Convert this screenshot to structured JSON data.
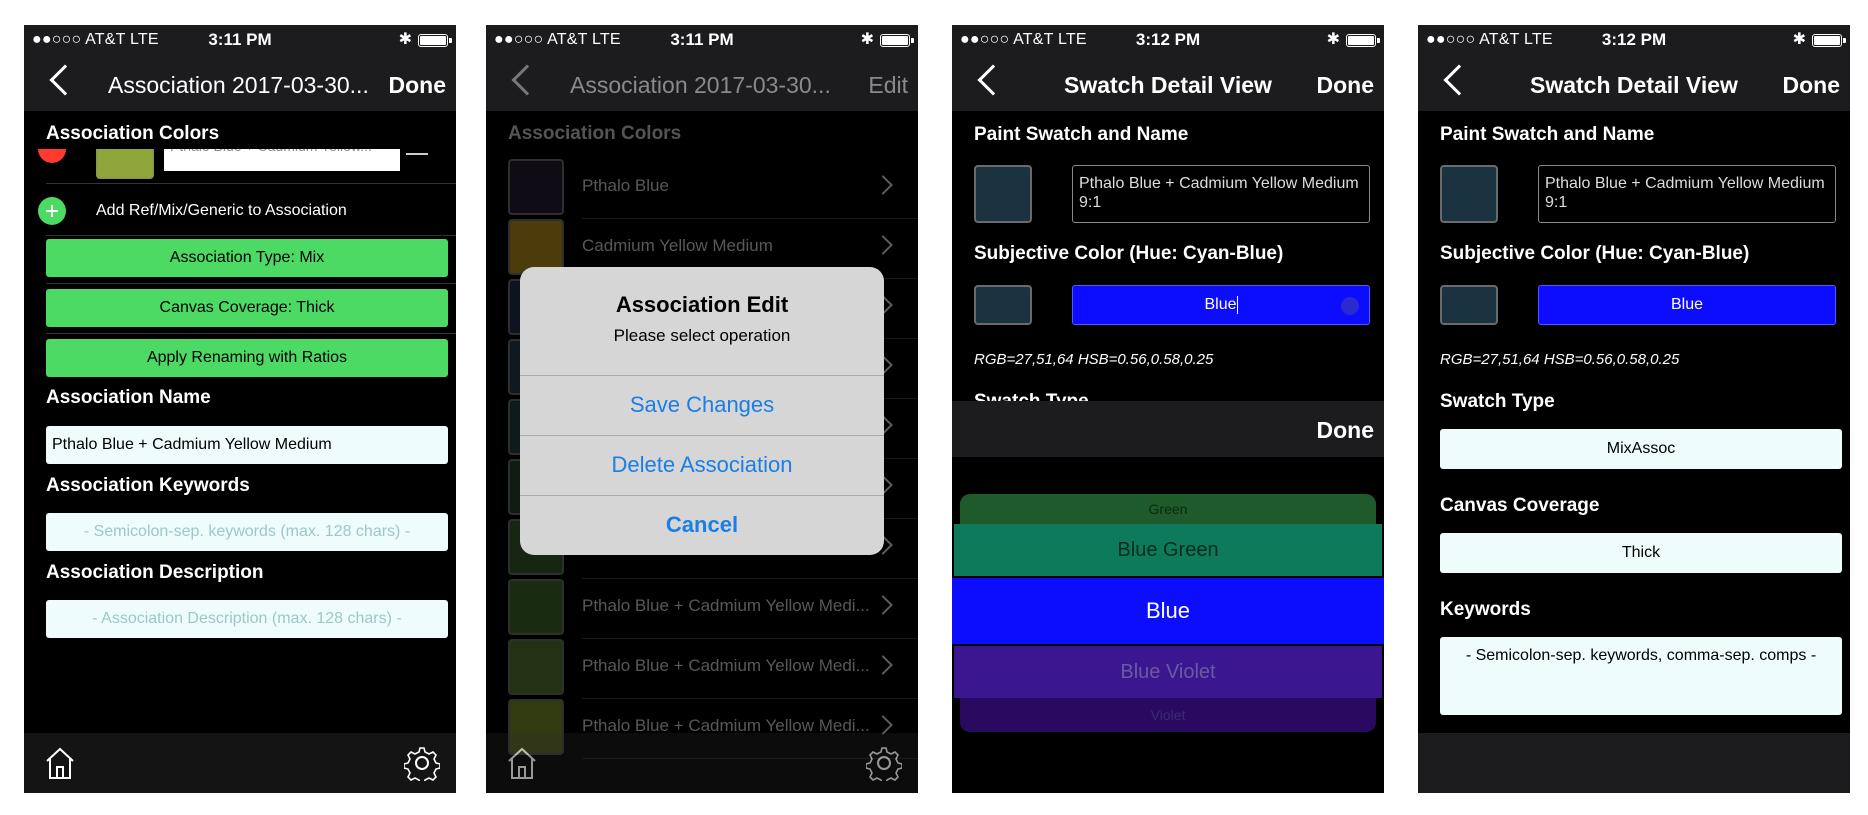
{
  "status": {
    "carrier": "●●○○○ AT&T  LTE",
    "bluetooth": "✱"
  },
  "screen1": {
    "time": "3:11 PM",
    "title": "Association 2017-03-30...",
    "done": "Done",
    "section_colors": "Association Colors",
    "partial_item": "Pthalo Blue + Cadmium Yellow...",
    "add_row": "Add Ref/Mix/Generic to Association",
    "btn_type": "Association Type: Mix",
    "btn_coverage": "Canvas Coverage: Thick",
    "btn_rename": "Apply Renaming with Ratios",
    "section_name": "Association Name",
    "name_value": "Pthalo Blue + Cadmium Yellow Medium",
    "section_keywords": "Association Keywords",
    "keywords_placeholder": "- Semicolon-sep. keywords (max. 128 chars) -",
    "section_description": "Association Description",
    "description_placeholder": "- Association Description (max. 128 chars) -"
  },
  "screen2": {
    "time": "3:11 PM",
    "title": "Association 2017-03-30...",
    "edit": "Edit",
    "section_colors": "Association Colors",
    "items": [
      {
        "label": "Pthalo Blue",
        "color": "#1c1628"
      },
      {
        "label": "Cadmium Yellow Medium",
        "color": "#8a6d14"
      },
      {
        "label": "",
        "color": "#18263a"
      },
      {
        "label": "",
        "color": "#1d2f3a"
      },
      {
        "label": "",
        "color": "#1c3030"
      },
      {
        "label": "",
        "color": "#1e3424"
      },
      {
        "label": "",
        "color": "#2a4424"
      },
      {
        "label": "Pthalo Blue + Cadmium Yellow Medi...",
        "color": "#2e4f1f"
      },
      {
        "label": "Pthalo Blue + Cadmium Yellow Medi...",
        "color": "#3f5c22"
      },
      {
        "label": "Pthalo Blue + Cadmium Yellow Medi...",
        "color": "#5c6a1e"
      }
    ],
    "alert": {
      "title": "Association Edit",
      "message": "Please select operation",
      "save": "Save Changes",
      "delete": "Delete Association",
      "cancel": "Cancel"
    }
  },
  "screen3": {
    "time": "3:12 PM",
    "title": "Swatch Detail View",
    "done": "Done",
    "section_paint": "Paint Swatch and Name",
    "swatch_name": "Pthalo Blue + Cadmium Yellow Medium 9:1",
    "section_subjective": "Subjective Color (Hue: Cyan-Blue)",
    "color_value": "Blue",
    "rgb_text": "RGB=27,51,64 HSB=0.56,0.58,0.25",
    "section_swatch_type_partial": "Swatch Type",
    "picker_done": "Done",
    "picker_options": [
      "Green",
      "Blue Green",
      "Blue",
      "Blue Violet",
      "Violet"
    ],
    "picker_selected": "Blue"
  },
  "screen4": {
    "time": "3:12 PM",
    "title": "Swatch Detail View",
    "done": "Done",
    "section_paint": "Paint Swatch and Name",
    "swatch_name": "Pthalo Blue + Cadmium Yellow Medium 9:1",
    "section_subjective": "Subjective Color (Hue: Cyan-Blue)",
    "color_value": "Blue",
    "rgb_text": "RGB=27,51,64 HSB=0.56,0.58,0.25",
    "section_swatch_type": "Swatch Type",
    "swatch_type_value": "MixAssoc",
    "section_canvas": "Canvas Coverage",
    "canvas_value": "Thick",
    "section_keywords": "Keywords",
    "keywords_placeholder": "- Semicolon-sep. keywords, comma-sep. comps -"
  },
  "colors": {
    "green_button": "#4cd964",
    "ios_blue": "#1a7ee6",
    "swatch_dark": "#1b3340",
    "selected_blue": "#0c0cff"
  }
}
